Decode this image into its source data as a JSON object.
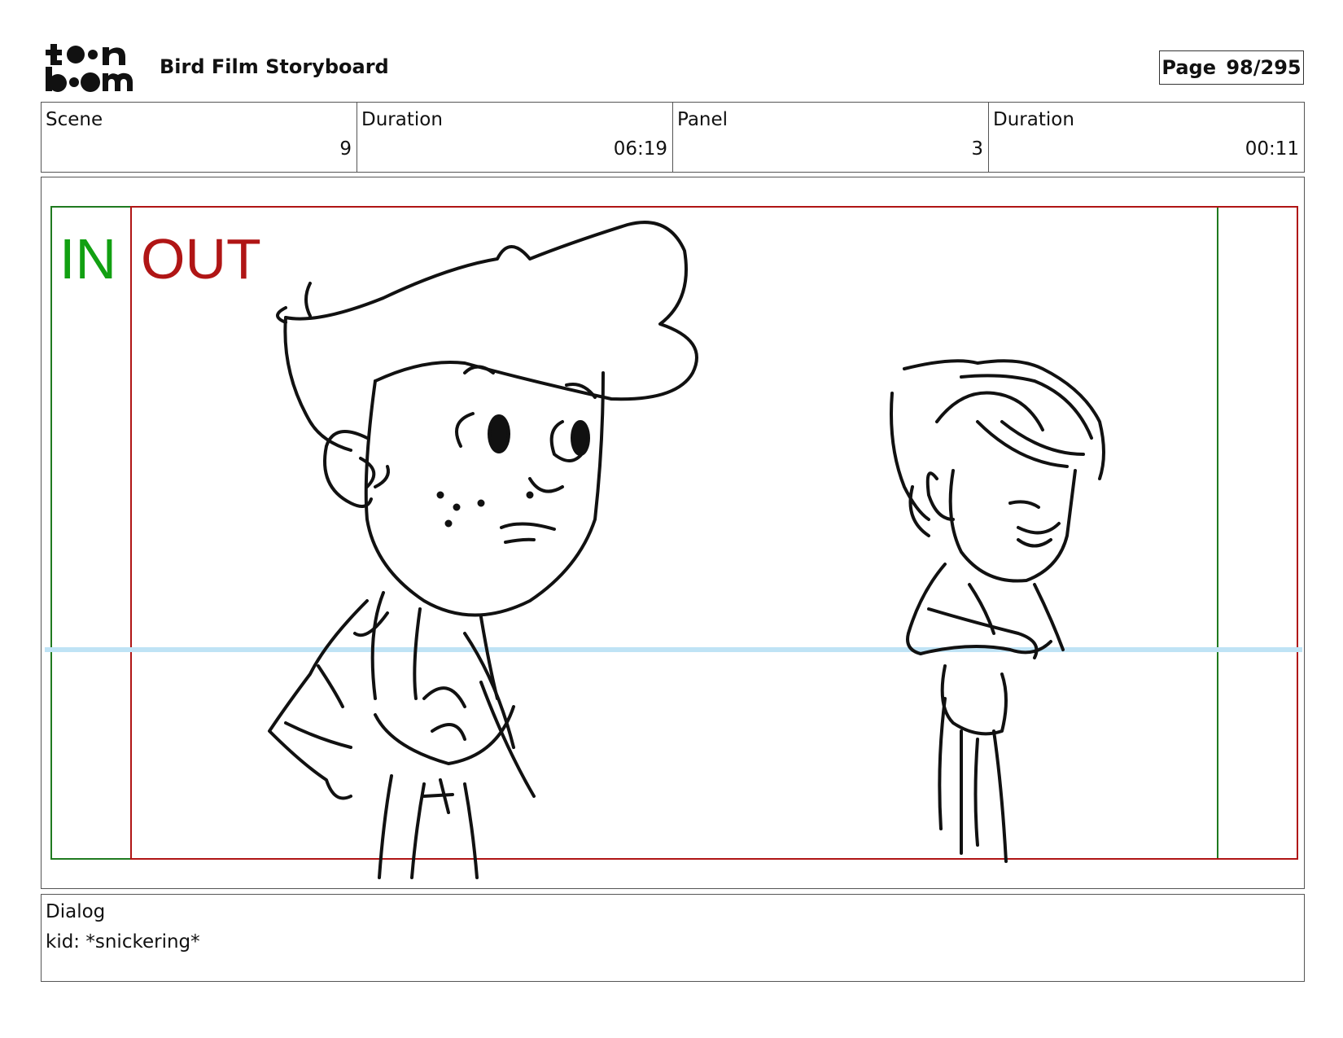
{
  "header": {
    "logo_line1": "toon",
    "logo_line2": "boom",
    "title": "Bird Film Storyboard",
    "page_label": "Page",
    "page_value": "98/295"
  },
  "info": [
    {
      "label": "Scene",
      "value": "9"
    },
    {
      "label": "Duration",
      "value": "06:19"
    },
    {
      "label": "Panel",
      "value": "3"
    },
    {
      "label": "Duration",
      "value": "00:11"
    }
  ],
  "panel": {
    "in_label": "IN",
    "out_label": "OUT",
    "colors": {
      "in": "#12a012",
      "out": "#b01515",
      "horizon": "#bfe3f5",
      "ink": "#111111"
    }
  },
  "dialog": {
    "label": "Dialog",
    "text": "kid: *snickering*"
  }
}
